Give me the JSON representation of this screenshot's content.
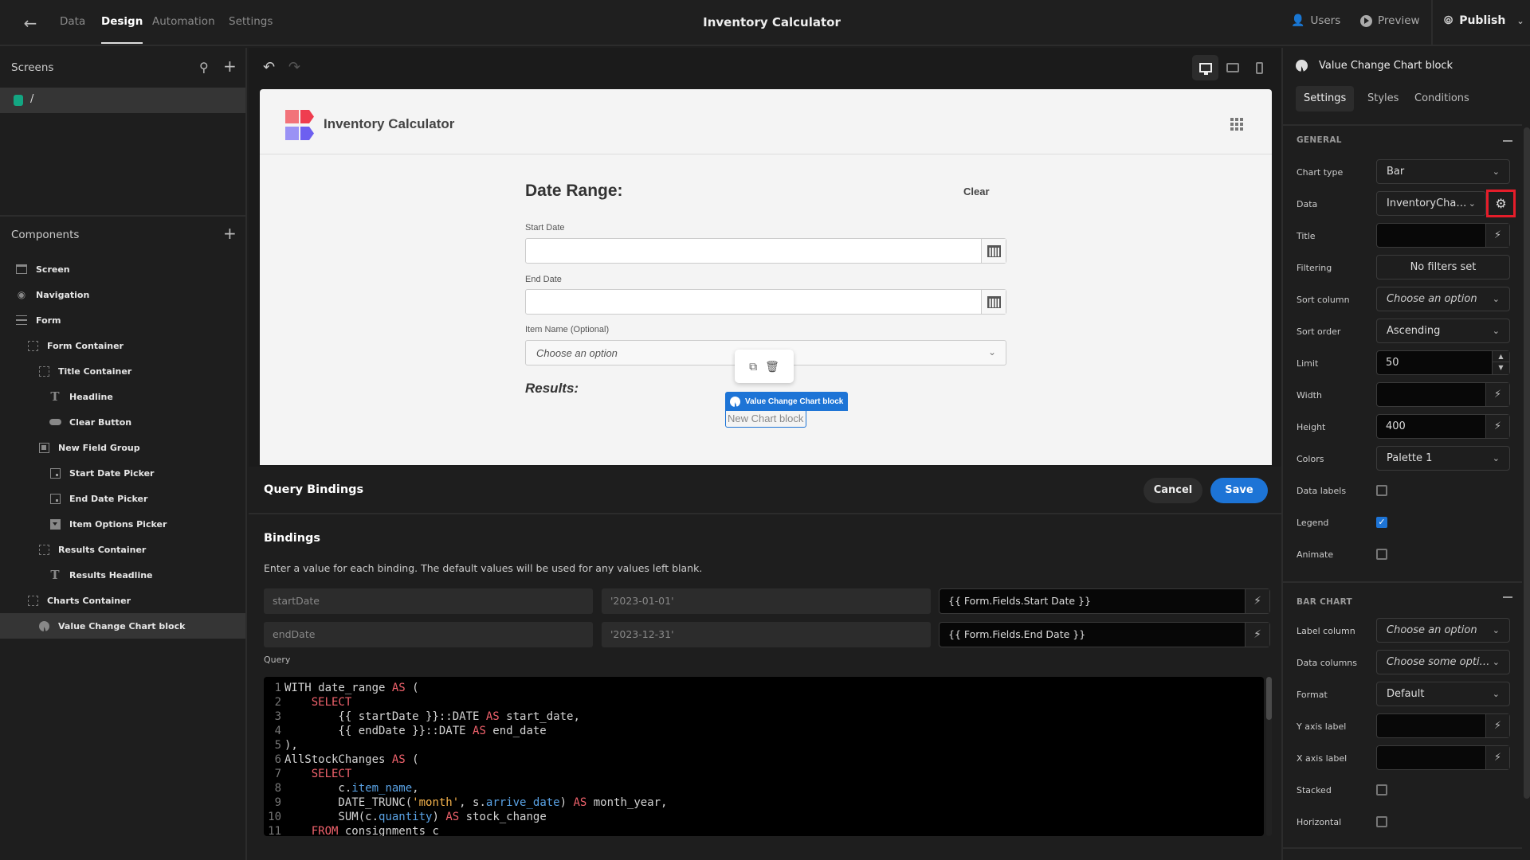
{
  "topbar": {
    "back_icon": "arrow-left-icon",
    "tabs": [
      {
        "label": "Data",
        "active": false
      },
      {
        "label": "Design",
        "active": true
      },
      {
        "label": "Automation",
        "active": false
      },
      {
        "label": "Settings",
        "active": false
      }
    ],
    "app_title": "Inventory Calculator",
    "users_label": "Users",
    "preview_label": "Preview",
    "publish_label": "Publish"
  },
  "screens": {
    "title": "Screens",
    "items": [
      {
        "label": "/",
        "color": "#13a682"
      }
    ]
  },
  "components": {
    "title": "Components",
    "tree": [
      {
        "label": "Screen",
        "icon": "screen-icon",
        "depth": 0
      },
      {
        "label": "Navigation",
        "icon": "eye-icon",
        "depth": 0
      },
      {
        "label": "Form",
        "icon": "form-icon",
        "depth": 0
      },
      {
        "label": "Form Container",
        "icon": "container-icon",
        "depth": 1
      },
      {
        "label": "Title Container",
        "icon": "container-icon",
        "depth": 2
      },
      {
        "label": "Headline",
        "icon": "text-icon",
        "depth": 3
      },
      {
        "label": "Clear Button",
        "icon": "button-icon",
        "depth": 3
      },
      {
        "label": "New Field Group",
        "icon": "field-group-icon",
        "depth": 2
      },
      {
        "label": "Start Date Picker",
        "icon": "calendar-icon",
        "depth": 3
      },
      {
        "label": "End Date Picker",
        "icon": "calendar-icon",
        "depth": 3
      },
      {
        "label": "Item Options Picker",
        "icon": "select-icon",
        "depth": 3
      },
      {
        "label": "Results Container",
        "icon": "container-icon",
        "depth": 2
      },
      {
        "label": "Results Headline",
        "icon": "text-icon",
        "depth": 3
      },
      {
        "label": "Charts Container",
        "icon": "container-icon",
        "depth": 1
      },
      {
        "label": "Value Change Chart block",
        "icon": "chart-icon",
        "depth": 2,
        "selected": true
      }
    ]
  },
  "canvas": {
    "app_title": "Inventory Calculator",
    "heading": "Date Range:",
    "clear_label": "Clear",
    "start_date_label": "Start Date",
    "start_date_value": "",
    "end_date_label": "End Date",
    "end_date_value": "",
    "item_label": "Item Name (Optional)",
    "item_placeholder": "Choose an option",
    "results_heading": "Results:",
    "chart_tag_label": "Value Change Chart block",
    "chart_block_text": "New Chart block"
  },
  "query_bindings": {
    "title": "Query Bindings",
    "cancel_label": "Cancel",
    "save_label": "Save",
    "bindings_title": "Bindings",
    "description": "Enter a value for each binding. The default values will be used for any values left blank.",
    "bindings": [
      {
        "name": "startDate",
        "default": "'2023-01-01'",
        "value": "{{ Form.Fields.Start Date }}"
      },
      {
        "name": "endDate",
        "default": "'2023-12-31'",
        "value": "{{ Form.Fields.End Date }}"
      }
    ],
    "query_label": "Query",
    "query_lines": [
      [
        {
          "t": "WITH date_range "
        },
        {
          "t": "AS",
          "c": "kw"
        },
        {
          "t": " ("
        }
      ],
      [
        {
          "t": "    "
        },
        {
          "t": "SELECT",
          "c": "kw"
        }
      ],
      [
        {
          "t": "        {{ startDate }}::DATE "
        },
        {
          "t": "AS",
          "c": "kw"
        },
        {
          "t": " start_date,"
        }
      ],
      [
        {
          "t": "        {{ endDate }}::DATE "
        },
        {
          "t": "AS",
          "c": "kw"
        },
        {
          "t": " end_date"
        }
      ],
      [
        {
          "t": "),"
        }
      ],
      [
        {
          "t": "AllStockChanges "
        },
        {
          "t": "AS",
          "c": "kw"
        },
        {
          "t": " ("
        }
      ],
      [
        {
          "t": "    "
        },
        {
          "t": "SELECT",
          "c": "kw"
        }
      ],
      [
        {
          "t": "        c."
        },
        {
          "t": "item_name",
          "c": "fld"
        },
        {
          "t": ","
        }
      ],
      [
        {
          "t": "        DATE_TRUNC("
        },
        {
          "t": "'month'",
          "c": "str"
        },
        {
          "t": ", s."
        },
        {
          "t": "arrive_date",
          "c": "fld"
        },
        {
          "t": ") "
        },
        {
          "t": "AS",
          "c": "kw"
        },
        {
          "t": " month_year,"
        }
      ],
      [
        {
          "t": "        SUM(c."
        },
        {
          "t": "quantity",
          "c": "fld"
        },
        {
          "t": ") "
        },
        {
          "t": "AS",
          "c": "kw"
        },
        {
          "t": " stock_change"
        }
      ],
      [
        {
          "t": "    "
        },
        {
          "t": "FROM",
          "c": "kw"
        },
        {
          "t": " consignments c"
        }
      ]
    ]
  },
  "settings_panel": {
    "component_name": "Value Change Chart block",
    "tabs": [
      {
        "label": "Settings",
        "active": true
      },
      {
        "label": "Styles",
        "active": false
      },
      {
        "label": "Conditions",
        "active": false
      }
    ],
    "general": {
      "title": "GENERAL",
      "chart_type_label": "Chart type",
      "chart_type": "Bar",
      "data_label": "Data",
      "data": "InventoryCha…",
      "title_label": "Title",
      "title_value": "",
      "filtering_label": "Filtering",
      "filtering": "No filters set",
      "sort_column_label": "Sort column",
      "sort_column": "Choose an option",
      "sort_order_label": "Sort order",
      "sort_order": "Ascending",
      "limit_label": "Limit",
      "limit": "50",
      "width_label": "Width",
      "width": "",
      "height_label": "Height",
      "height": "400",
      "colors_label": "Colors",
      "colors": "Palette 1",
      "data_labels_label": "Data labels",
      "data_labels": false,
      "legend_label": "Legend",
      "legend": true,
      "animate_label": "Animate",
      "animate": false
    },
    "bar_chart": {
      "title": "BAR CHART",
      "label_column_label": "Label column",
      "label_column": "Choose an option",
      "data_columns_label": "Data columns",
      "data_columns": "Choose some opti…",
      "format_label": "Format",
      "format": "Default",
      "y_axis_label": "Y axis label",
      "y_axis": "",
      "x_axis_label": "X axis label",
      "x_axis": "",
      "stacked_label": "Stacked",
      "stacked": false,
      "horizontal_label": "Horizontal",
      "horizontal": false
    },
    "highlight_color": "#e51d2a",
    "accent_color": "#1d74d6"
  }
}
